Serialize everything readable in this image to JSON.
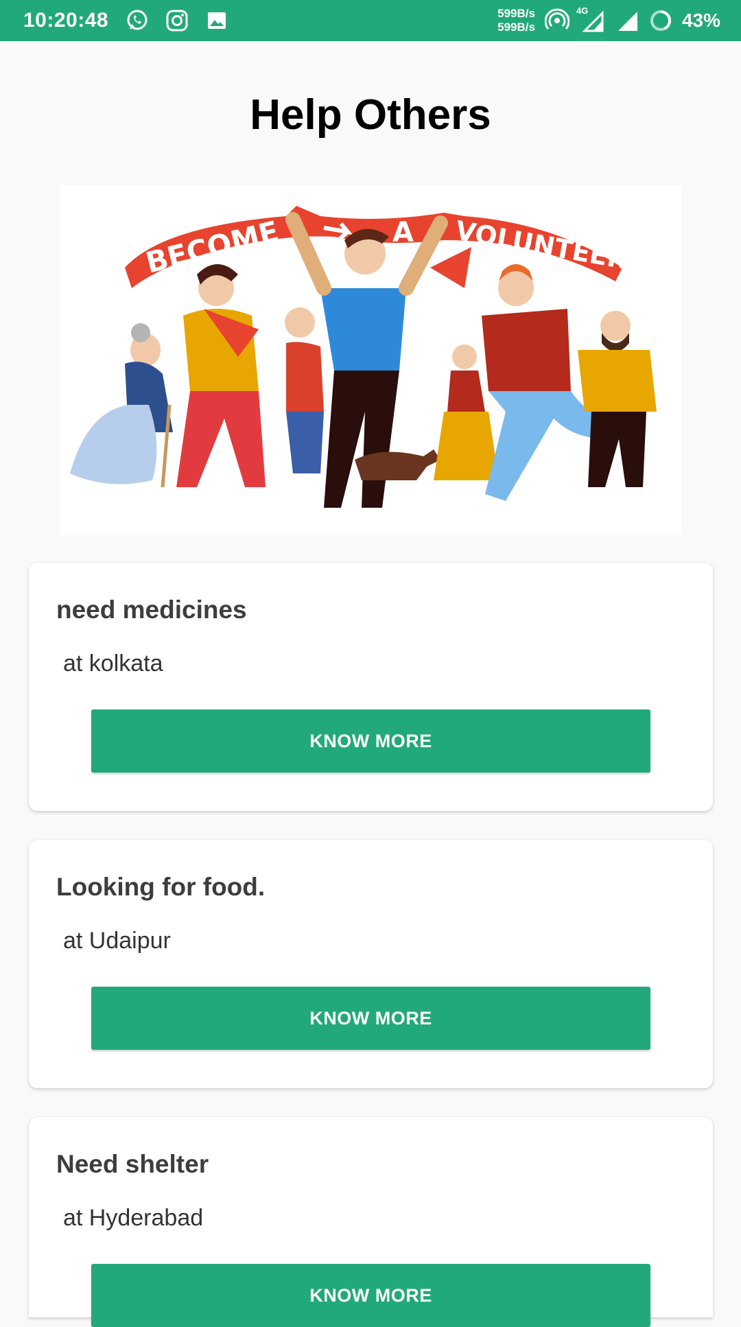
{
  "status_bar": {
    "time": "10:20:48",
    "net_speed_up": "599B/s",
    "net_speed_down": "599B/s",
    "network_type": "4G",
    "battery": "43%",
    "icons": [
      "whatsapp-icon",
      "instagram-icon",
      "gallery-icon",
      "hotspot-icon",
      "signal-icon",
      "battery-icon"
    ]
  },
  "page": {
    "title": "Help Others"
  },
  "hero": {
    "banner_words": [
      "BECOME",
      "A",
      "VOLUNTEER"
    ],
    "colors": {
      "banner": "#e8432e",
      "accent": "#22a97a"
    }
  },
  "requests": [
    {
      "title": "need medicines",
      "location": "at kolkata",
      "button_label": "KNOW MORE"
    },
    {
      "title": "Looking for food.",
      "location": "at Udaipur",
      "button_label": "KNOW MORE"
    },
    {
      "title": "Need shelter",
      "location": "at Hyderabad",
      "button_label": "KNOW MORE"
    }
  ]
}
